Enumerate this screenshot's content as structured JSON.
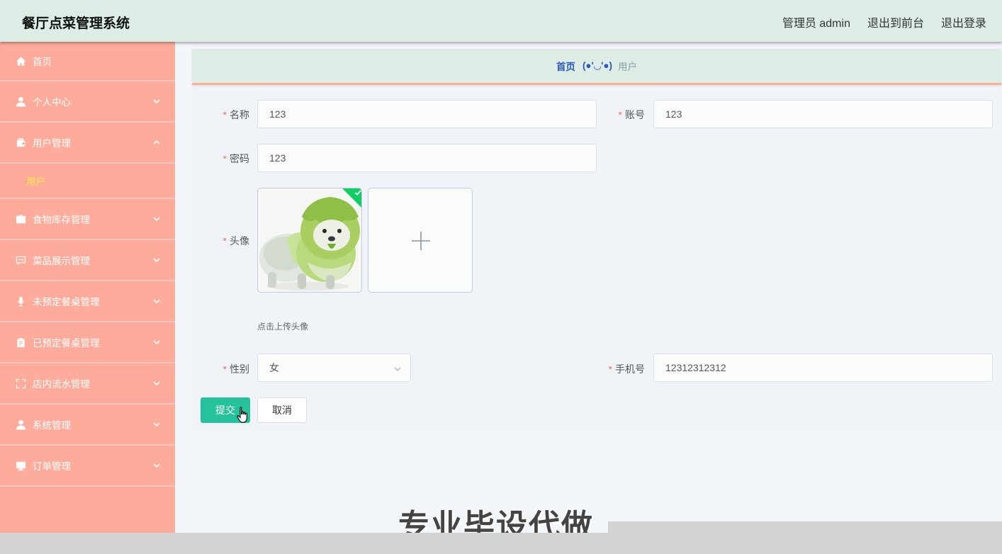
{
  "header": {
    "title": "餐厅点菜管理系统",
    "user": "管理员 admin",
    "to_front": "退出到前台",
    "logout": "退出登录"
  },
  "sidebar": {
    "items": [
      {
        "label": "首页",
        "icon": "home-icon"
      },
      {
        "label": "个人中心",
        "icon": "user-icon"
      },
      {
        "label": "用户管理",
        "icon": "wallet-icon",
        "expanded": true,
        "children": [
          {
            "label": "用户",
            "active": true
          }
        ]
      },
      {
        "label": "食物库存管理",
        "icon": "briefcase-icon"
      },
      {
        "label": "菜品展示管理",
        "icon": "chat-icon"
      },
      {
        "label": "未预定餐桌管理",
        "icon": "microphone-icon"
      },
      {
        "label": "已预定餐桌管理",
        "icon": "clipboard-icon"
      },
      {
        "label": "店内流水管理",
        "icon": "fullscreen-icon"
      },
      {
        "label": "系统管理",
        "icon": "user-icon"
      },
      {
        "label": "订单管理",
        "icon": "monitor-icon"
      }
    ]
  },
  "breadcrumb": {
    "home": "首页",
    "emoji": "(●'◡'●)",
    "current": "用户"
  },
  "form": {
    "name_label": "名称",
    "name_value": "123",
    "account_label": "账号",
    "account_value": "123",
    "password_label": "密码",
    "password_value": "123",
    "avatar_label": "头像",
    "avatar_tip": "点击上传头像",
    "gender_label": "性别",
    "gender_value": "女",
    "phone_label": "手机号",
    "phone_value": "12312312312",
    "submit": "提交",
    "cancel": "取消"
  },
  "colors": {
    "header_bg": "#ddede6",
    "sidebar_bg": "#fdac9b",
    "submenu_active": "#ffe94d",
    "primary": "#26c29b",
    "required": "#f56c6c",
    "breadcrumb_link": "#2d59b7"
  },
  "watermark": "专业毕设代做"
}
